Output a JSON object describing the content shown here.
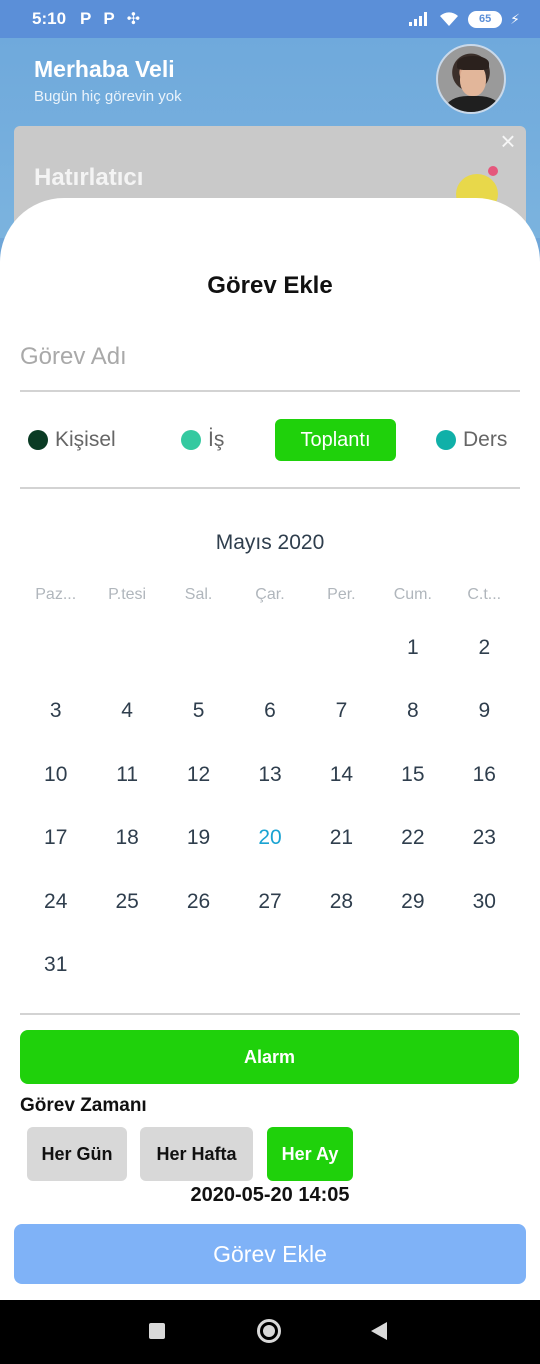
{
  "status_bar": {
    "time": "5:10",
    "app_icons": [
      "P",
      "P"
    ],
    "battery": "65"
  },
  "header": {
    "greeting": "Merhaba Veli",
    "subtitle": "Bugün hiç görevin yok"
  },
  "reminder": {
    "title": "Hatırlatıcı"
  },
  "sheet": {
    "title": "Görev Ekle",
    "task_name_placeholder": "Görev Adı",
    "categories": [
      {
        "label": "Kişisel",
        "color": "#0a3b24",
        "selected": false
      },
      {
        "label": "İş",
        "color": "#34c9a0",
        "selected": false
      },
      {
        "label": "Toplantı",
        "color": "#1fd10b",
        "selected": true
      },
      {
        "label": "Ders",
        "color": "#10b0a8",
        "selected": false
      }
    ],
    "calendar": {
      "month": "Mayıs 2020",
      "weekdays": [
        "Paz...",
        "P.tesi",
        "Sal.",
        "Çar.",
        "Per.",
        "Cum.",
        "C.t..."
      ],
      "days": [
        "",
        "",
        "",
        "",
        "",
        "1",
        "2",
        "3",
        "4",
        "5",
        "6",
        "7",
        "8",
        "9",
        "10",
        "11",
        "12",
        "13",
        "14",
        "15",
        "16",
        "17",
        "18",
        "19",
        "20",
        "21",
        "22",
        "23",
        "24",
        "25",
        "26",
        "27",
        "28",
        "29",
        "30",
        "31"
      ],
      "today": "20"
    },
    "alarm_label": "Alarm",
    "time_label": "Görev Zamanı",
    "frequency": [
      {
        "label": "Her Gün",
        "selected": false
      },
      {
        "label": "Her Hafta",
        "selected": false
      },
      {
        "label": "Her Ay",
        "selected": true
      }
    ],
    "datetime": "2020-05-20 14:05",
    "submit_label": "Görev Ekle"
  },
  "colors": {
    "accent_green": "#1fd10b",
    "submit_blue": "#7fb2f7",
    "today_blue": "#1aa3d2"
  }
}
